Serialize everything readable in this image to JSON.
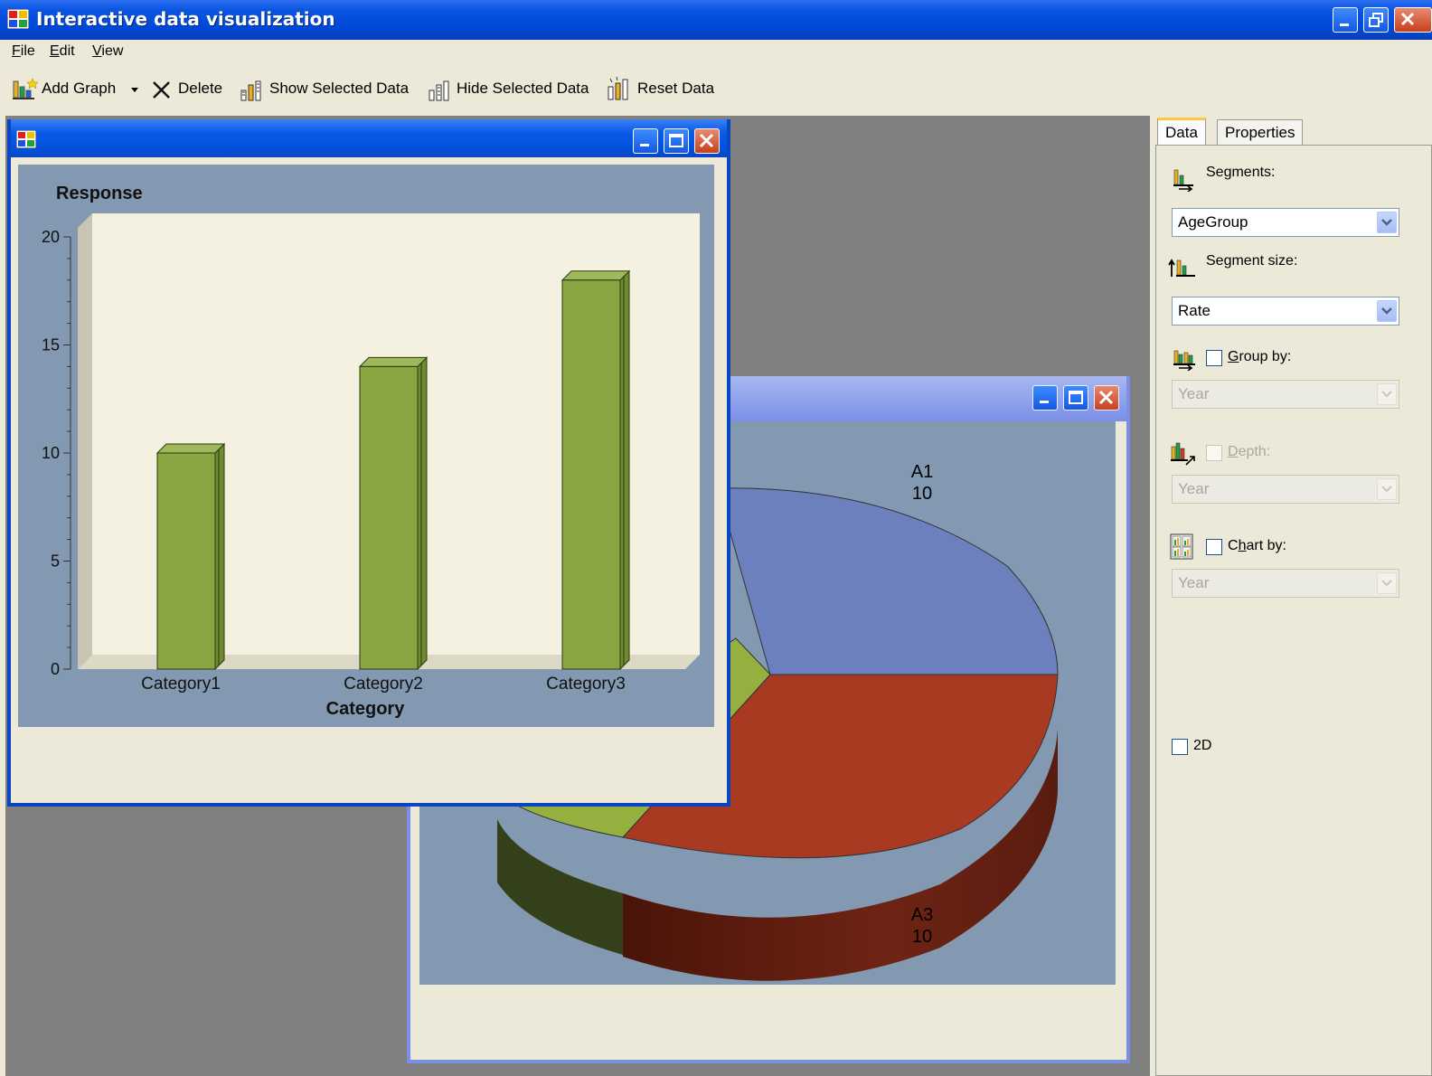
{
  "window": {
    "title": "Interactive data visualization"
  },
  "menu": {
    "items": [
      {
        "label": "File",
        "accel": "F",
        "rest": "ile"
      },
      {
        "label": "Edit",
        "accel": "E",
        "rest": "dit"
      },
      {
        "label": "View",
        "accel": "V",
        "rest": "iew"
      }
    ]
  },
  "toolbar": {
    "add_graph": "Add Graph",
    "delete": "Delete",
    "show_selected": "Show Selected Data",
    "hide_selected": "Hide Selected Data",
    "reset": "Reset Data"
  },
  "bar_window": {
    "chart_data": {
      "type": "bar",
      "title": "Response",
      "xlabel": "Category",
      "ylabel": "",
      "categories": [
        "Category1",
        "Category2",
        "Category3"
      ],
      "values": [
        10,
        14,
        18
      ],
      "ylim": [
        0,
        20
      ],
      "yticks": [
        0,
        5,
        10,
        15,
        20
      ],
      "bar_color": "#8aa642",
      "plot_bg": "#f4f1e1",
      "frame_bg": "#8399b1",
      "grid": false
    }
  },
  "pie_window": {
    "chart_data": {
      "type": "pie",
      "style": "3d",
      "visible_slices": [
        {
          "label": "A1",
          "value": 10,
          "color": "#6b80bd"
        },
        {
          "label": "A3",
          "value": 10,
          "color": "#a83a22"
        },
        {
          "label": "",
          "value": null,
          "color": "#96b040"
        }
      ],
      "frame_bg": "#8399b1"
    }
  },
  "panel": {
    "tabs": [
      {
        "label": "Data",
        "active": true
      },
      {
        "label": "Properties",
        "active": false
      }
    ],
    "segments_label": "Segments:",
    "segments_value": "AgeGroup",
    "segment_size_label": "Segment size:",
    "segment_size_value": "Rate",
    "group_by": {
      "label_accel": "G",
      "label_rest": "roup by:",
      "checked": false,
      "value": "Year",
      "enabled": true
    },
    "depth": {
      "label_accel": "D",
      "label_rest": "epth:",
      "checked": false,
      "value": "Year",
      "enabled": false
    },
    "chart_by": {
      "label_pre": "C",
      "label_accel": "h",
      "label_rest": "art by:",
      "checked": false,
      "value": "Year",
      "enabled": true
    },
    "two_d": {
      "label": "2D",
      "checked": false
    }
  },
  "colors": {
    "titlebar": "#0a55e2",
    "mdi_bg": "#808080",
    "panel_bg": "#ece9d8"
  }
}
